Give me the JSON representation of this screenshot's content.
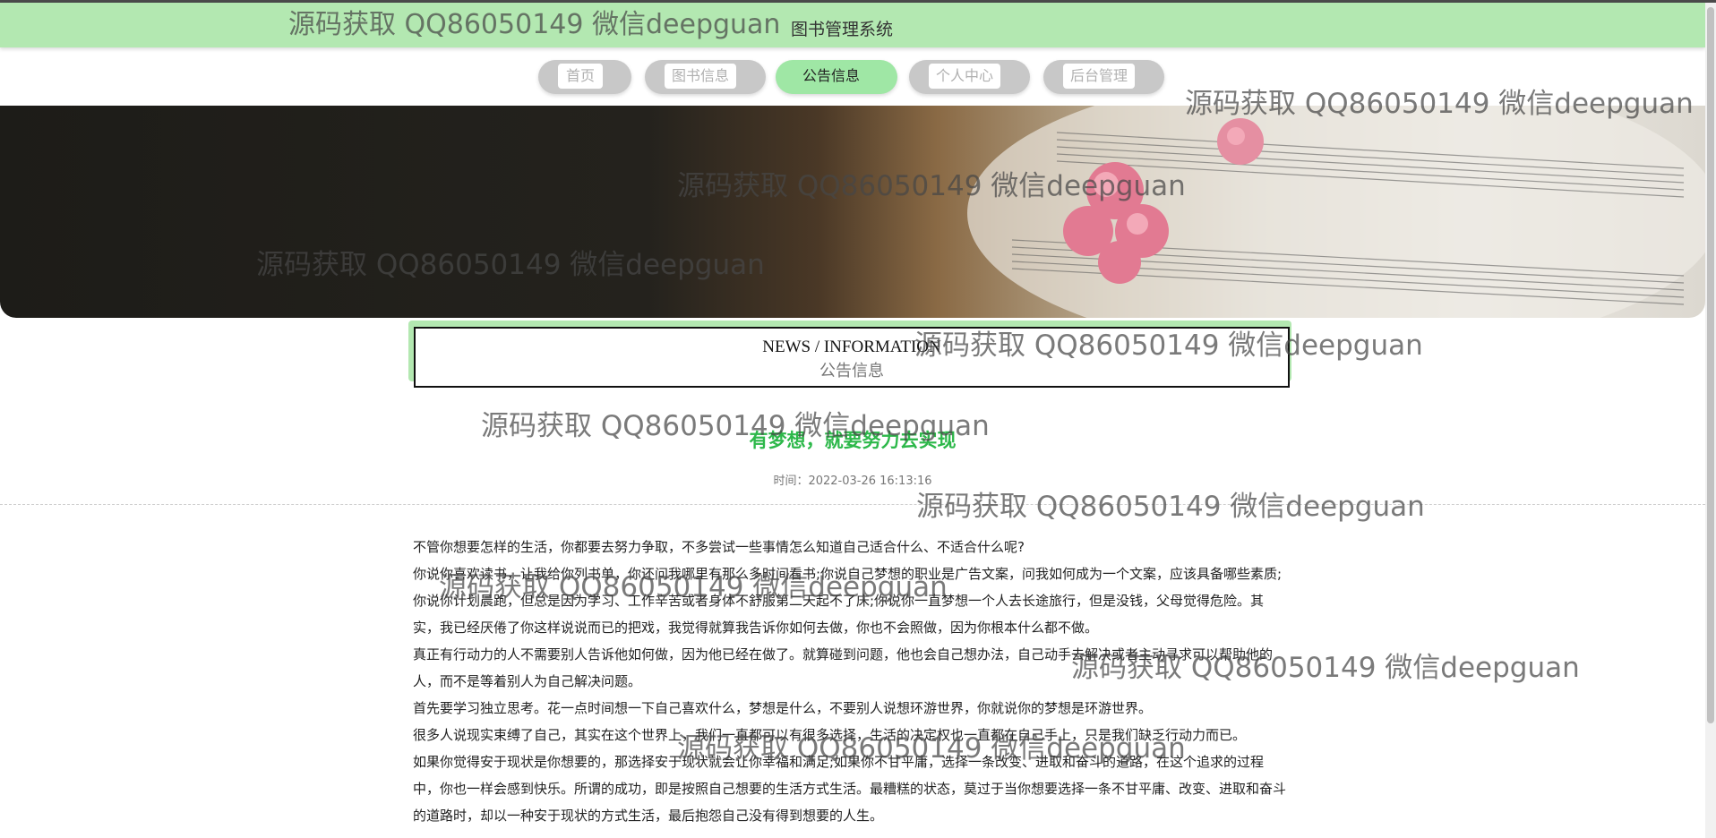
{
  "header": {
    "site_title": "图书管理系统"
  },
  "nav": {
    "items": [
      {
        "label": "首页",
        "active": false
      },
      {
        "label": "图书信息",
        "active": false
      },
      {
        "label": "公告信息",
        "active": true
      },
      {
        "label": "个人中心",
        "active": false
      },
      {
        "label": "后台管理",
        "active": false
      }
    ]
  },
  "section": {
    "title_en": "NEWS / INFORMATION",
    "title_zh": "公告信息"
  },
  "article": {
    "title": "有梦想，就要努力去实现",
    "time": "时间：2022-03-26 16:13:16",
    "paragraphs": [
      "不管你想要怎样的生活，你都要去努力争取，不多尝试一些事情怎么知道自己适合什么、不适合什么呢?",
      "你说你喜欢读书，让我给你列书单，你还问我哪里有那么多时间看书;你说自己梦想的职业是广告文案，问我如何成为一个文案，应该具备哪些素质;你说你计划晨跑，但总是因为学习、工作辛苦或者身体不舒服第二天起不了床;你说你一直梦想一个人去长途旅行，但是没钱，父母觉得危险。其实，我已经厌倦了你这样说说而已的把戏，我觉得就算我告诉你如何去做，你也不会照做，因为你根本什么都不做。",
      "真正有行动力的人不需要别人告诉他如何做，因为他已经在做了。就算碰到问题，他也会自己想办法，自己动手去解决或者主动寻求可以帮助他的人，而不是等着别人为自己解决问题。",
      "首先要学习独立思考。花一点时间想一下自己喜欢什么，梦想是什么，不要别人说想环游世界，你就说你的梦想是环游世界。",
      "很多人说现实束缚了自己，其实在这个世界上，我们一直都可以有很多选择，生活的决定权也一直都在自己手上，只是我们缺乏行动力而已。",
      "如果你觉得安于现状是你想要的，那选择安于现状就会让你幸福和满足;如果你不甘平庸，选择一条改变、进取和奋斗的道路，在这个追求的过程中，你也一样会感到快乐。所谓的成功，即是按照自己想要的生活方式生活。最糟糕的状态，莫过于当你想要选择一条不甘平庸、改变、进取和奋斗的道路时，却以一种安于现状的方式生活，最后抱怨自己没有得到想要的人生。"
    ]
  },
  "watermark": {
    "text": "源码获取 QQ86050149 微信deepguan"
  },
  "colors": {
    "header_bg": "#b3e8b1",
    "nav_active": "#9fe7a5",
    "nav_inactive": "#c8c8c8",
    "title_green": "#2db84a"
  }
}
